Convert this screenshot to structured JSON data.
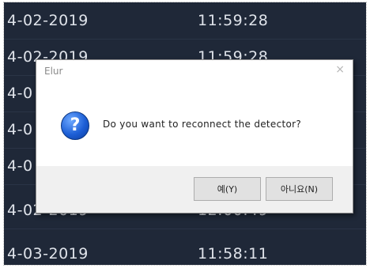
{
  "log": {
    "rows": [
      {
        "date": "4-02-2019",
        "time": "11:59:28"
      },
      {
        "date": "4-02-2019",
        "time": "11:59:28"
      },
      {
        "date": "4-0",
        "time": ""
      },
      {
        "date": "4-0",
        "time": ""
      },
      {
        "date": "4-0",
        "time": ""
      },
      {
        "date": "4-02-2019",
        "time": "12:00:49"
      },
      {
        "date": "4-03-2019",
        "time": "11:58:11"
      }
    ]
  },
  "dialog": {
    "title": "Elur",
    "close_glyph": "×",
    "icon_glyph": "?",
    "message": "Do you want to reconnect the detector?",
    "buttons": {
      "yes": "예(Y)",
      "no": "아니요(N)"
    }
  },
  "colors": {
    "background": "#1f2838",
    "dialog_icon": "#1d5fd6"
  }
}
